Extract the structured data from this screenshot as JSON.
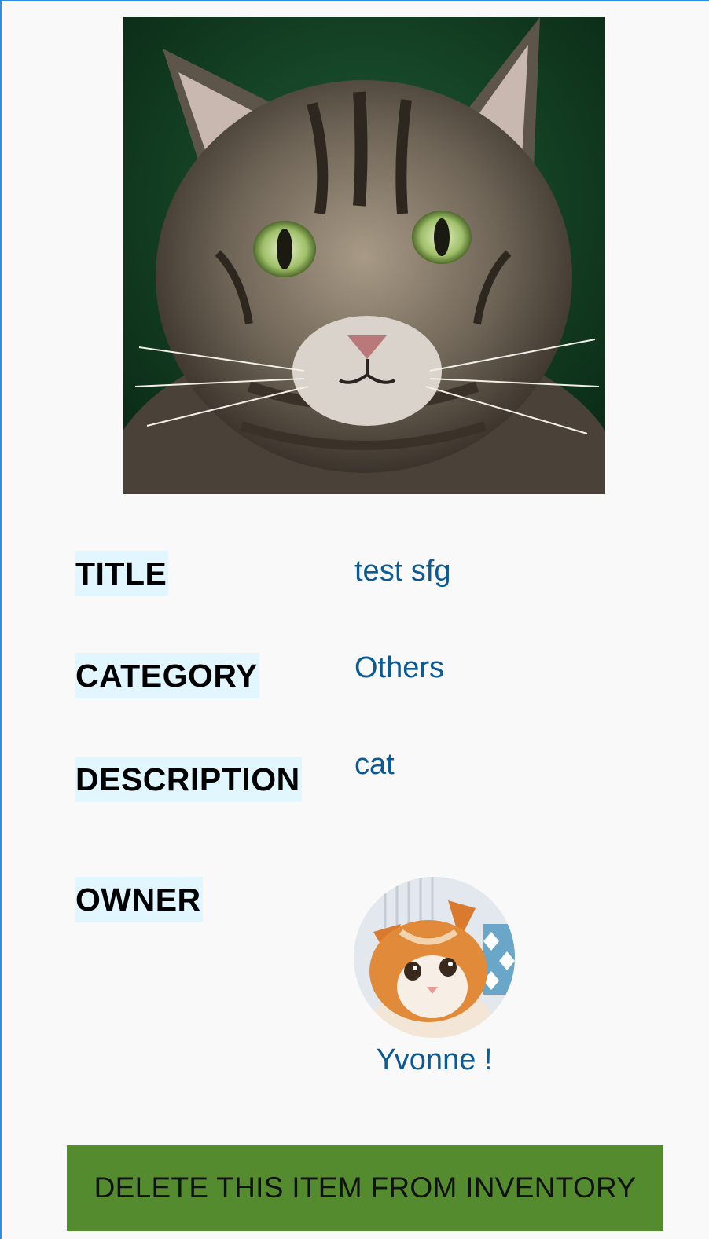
{
  "item": {
    "photo_alt": "cat-photo",
    "fields": [
      {
        "label": "TITLE",
        "value": "test sfg"
      },
      {
        "label": "CATEGORY",
        "value": "Others"
      },
      {
        "label": "DESCRIPTION",
        "value": "cat"
      }
    ],
    "owner": {
      "label": "OWNER",
      "name": "Yvonne !",
      "avatar_icon": "owner-avatar-image"
    }
  },
  "actions": {
    "delete_label": "DELETE THIS ITEM FROM INVENTORY"
  },
  "colors": {
    "background": "#f9f9f9",
    "label_highlight": "#e2f6ff",
    "value_text": "#0b5a94",
    "delete_button": "#548b2e",
    "frame_border": "#2f8de4"
  }
}
